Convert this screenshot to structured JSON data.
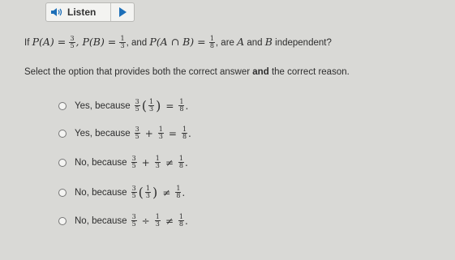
{
  "listen": {
    "label": "Listen",
    "speaker_icon": "speaker-icon",
    "play_icon": "play-icon"
  },
  "question": {
    "prefix": "If",
    "pa": "P(A) =",
    "pa_num": "3",
    "pa_den": "5",
    "pb": ", P(B) =",
    "pb_num": "1",
    "pb_den": "3",
    "mid": ", and",
    "pab": "P(A ∩ B) =",
    "pab_num": "1",
    "pab_den": "8",
    "tail": ", are",
    "a": "A",
    "and": "and",
    "b": "B",
    "end": "independent?"
  },
  "instruction": {
    "before": "Select the option that provides both the correct answer",
    "bold": "and",
    "after": "the correct reason."
  },
  "options": [
    {
      "label": "Yes, because",
      "f1n": "3",
      "f1d": "5",
      "op": "",
      "f2n": "1",
      "f2d": "3",
      "rel": "=",
      "f3n": "1",
      "f3d": "8",
      "paren": true
    },
    {
      "label": "Yes, because",
      "f1n": "3",
      "f1d": "5",
      "op": "+",
      "f2n": "1",
      "f2d": "3",
      "rel": "=",
      "f3n": "1",
      "f3d": "8",
      "paren": false
    },
    {
      "label": "No, because",
      "f1n": "3",
      "f1d": "5",
      "op": "+",
      "f2n": "1",
      "f2d": "3",
      "rel": "≠",
      "f3n": "1",
      "f3d": "8",
      "paren": false
    },
    {
      "label": "No, because",
      "f1n": "3",
      "f1d": "5",
      "op": "",
      "f2n": "1",
      "f2d": "3",
      "rel": "≠",
      "f3n": "1",
      "f3d": "8",
      "paren": true
    },
    {
      "label": "No, because",
      "f1n": "3",
      "f1d": "5",
      "op": "÷",
      "f2n": "1",
      "f2d": "3",
      "rel": "≠",
      "f3n": "1",
      "f3d": "8",
      "paren": false
    }
  ]
}
